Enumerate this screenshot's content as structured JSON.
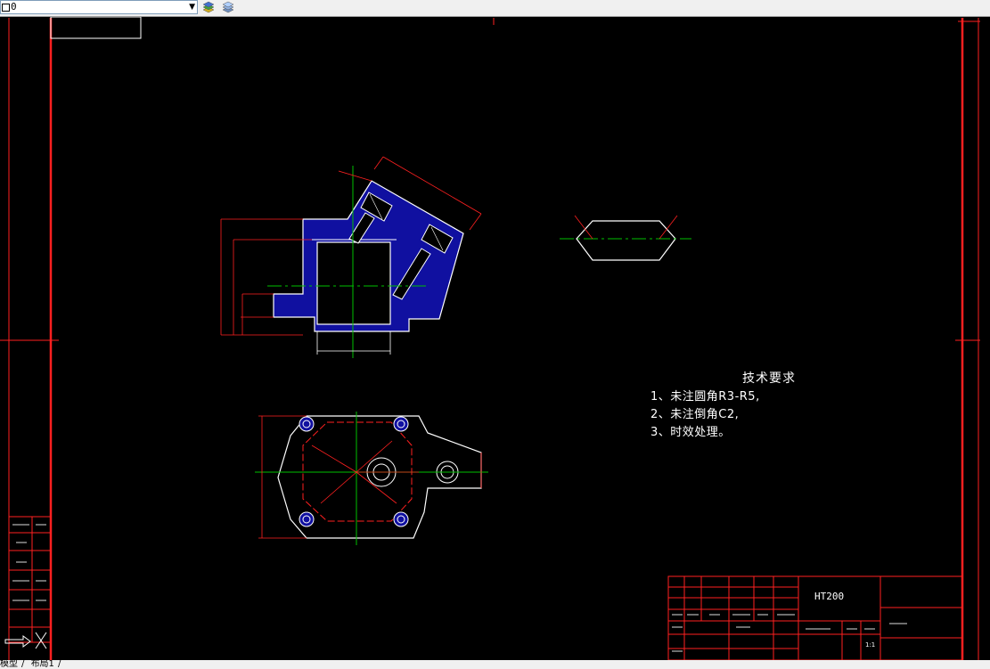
{
  "toolbar": {
    "layer_value": "0",
    "icons": [
      "layer-properties-icon",
      "layer-previous-icon"
    ]
  },
  "colors": {
    "background": "#000000",
    "border": "#ff2020",
    "part_fill": "#1010a0",
    "outline": "#ffffff",
    "centerline": "#00c000",
    "dimension": "#ff2020"
  },
  "tech_requirements": {
    "title": "技术要求",
    "items": [
      "1、未注圆角R3-R5,",
      "2、未注倒角C2,",
      "3、时效处理。"
    ]
  },
  "title_block": {
    "material": "HT200",
    "scale": "1:1"
  },
  "layout_tabs": [
    "模型",
    "布局1"
  ]
}
